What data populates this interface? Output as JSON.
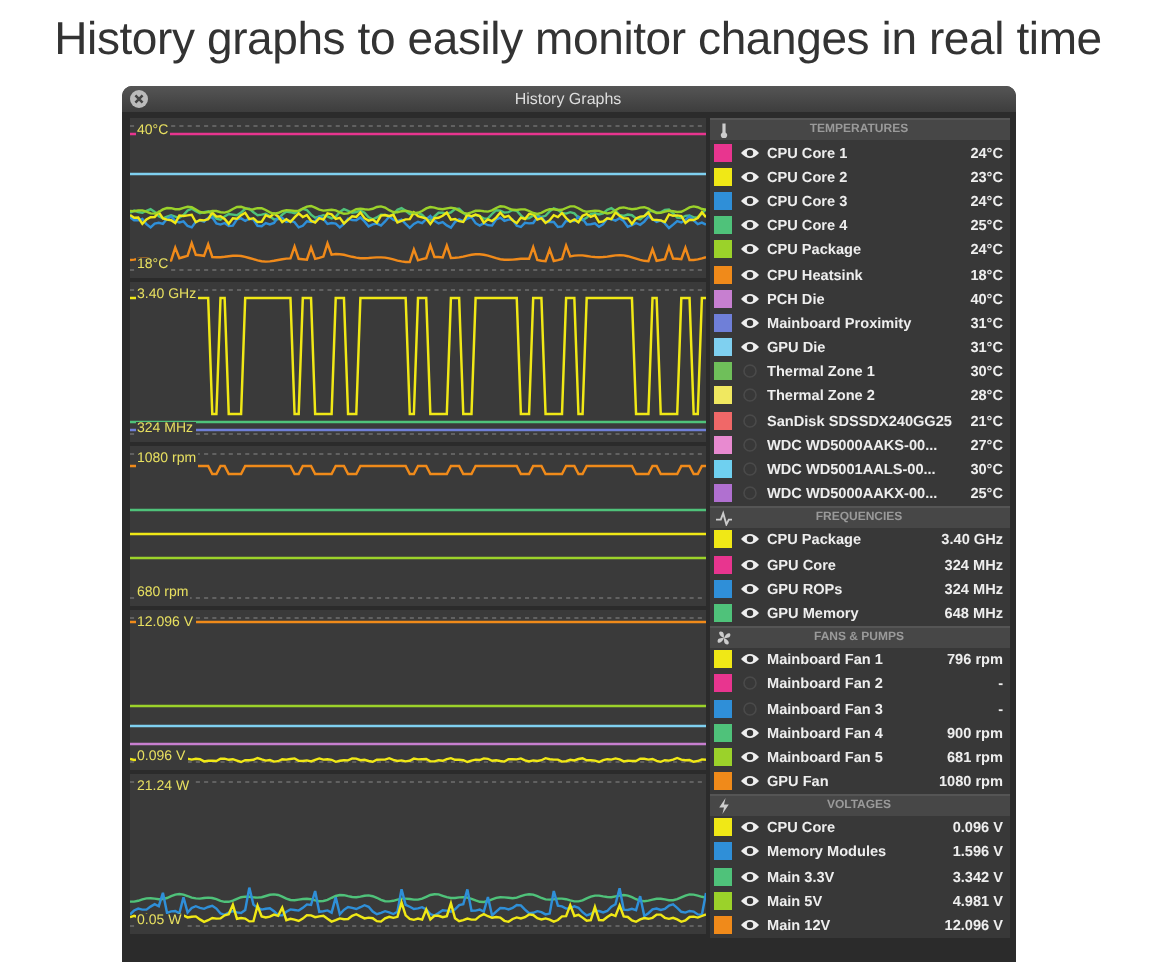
{
  "heading": "History graphs to easily monitor changes in real time",
  "window": {
    "title": "History Graphs"
  },
  "graphs": [
    {
      "kind": "temperatures",
      "top_label": "40°C",
      "bottom_label": "18°C"
    },
    {
      "kind": "frequencies",
      "top_label": "3.40 GHz",
      "bottom_label": "324 MHz"
    },
    {
      "kind": "fans",
      "top_label": "1080 rpm",
      "bottom_label": "680 rpm"
    },
    {
      "kind": "voltages",
      "top_label": "12.096 V",
      "bottom_label": "0.096 V"
    },
    {
      "kind": "power",
      "top_label": "21.24 W",
      "bottom_label": "0.05 W"
    }
  ],
  "sections": [
    {
      "kind": "temperatures",
      "title": "TEMPERATURES",
      "items": [
        {
          "name": "CPU Core 1",
          "value": "24°C",
          "color": "#e8358f",
          "visible": true
        },
        {
          "name": "CPU Core 2",
          "value": "23°C",
          "color": "#f0e816",
          "visible": true
        },
        {
          "name": "CPU Core 3",
          "value": "24°C",
          "color": "#2f8fd8",
          "visible": true
        },
        {
          "name": "CPU Core 4",
          "value": "25°C",
          "color": "#4fc27a",
          "visible": true
        },
        {
          "name": "CPU Package",
          "value": "24°C",
          "color": "#9bd22a",
          "visible": true
        },
        {
          "name": "CPU Heatsink",
          "value": "18°C",
          "color": "#f08a1a",
          "visible": true
        },
        {
          "name": "PCH Die",
          "value": "40°C",
          "color": "#c77fd0",
          "visible": true
        },
        {
          "name": "Mainboard Proximity",
          "value": "31°C",
          "color": "#6f7fd8",
          "visible": true
        },
        {
          "name": "GPU Die",
          "value": "31°C",
          "color": "#7fd0f0",
          "visible": true
        },
        {
          "name": "Thermal Zone 1",
          "value": "30°C",
          "color": "#6fbf5a",
          "visible": false
        },
        {
          "name": "Thermal Zone 2",
          "value": "28°C",
          "color": "#f0e860",
          "visible": false
        },
        {
          "name": "SanDisk SDSSDX240GG25",
          "value": "21°C",
          "color": "#f06868",
          "visible": false
        },
        {
          "name": "WDC WD5000AAKS-00...",
          "value": "27°C",
          "color": "#e88ad0",
          "visible": false
        },
        {
          "name": "WDC WD5001AALS-00...",
          "value": "30°C",
          "color": "#6fd0f0",
          "visible": false
        },
        {
          "name": "WDC WD5000AAKX-00...",
          "value": "25°C",
          "color": "#b070d0",
          "visible": false
        }
      ]
    },
    {
      "kind": "frequencies",
      "title": "FREQUENCIES",
      "items": [
        {
          "name": "CPU Package",
          "value": "3.40 GHz",
          "color": "#f0e816",
          "visible": true
        },
        {
          "name": "GPU Core",
          "value": "324 MHz",
          "color": "#e8358f",
          "visible": true
        },
        {
          "name": "GPU ROPs",
          "value": "324 MHz",
          "color": "#2f8fd8",
          "visible": true
        },
        {
          "name": "GPU Memory",
          "value": "648 MHz",
          "color": "#4fc27a",
          "visible": true
        }
      ]
    },
    {
      "kind": "fans",
      "title": "FANS & PUMPS",
      "items": [
        {
          "name": "Mainboard Fan 1",
          "value": "796 rpm",
          "color": "#f0e816",
          "visible": true
        },
        {
          "name": "Mainboard Fan 2",
          "value": "-",
          "color": "#e8358f",
          "visible": false
        },
        {
          "name": "Mainboard Fan 3",
          "value": "-",
          "color": "#2f8fd8",
          "visible": false
        },
        {
          "name": "Mainboard Fan 4",
          "value": "900 rpm",
          "color": "#4fc27a",
          "visible": true
        },
        {
          "name": "Mainboard Fan 5",
          "value": "681 rpm",
          "color": "#9bd22a",
          "visible": true
        },
        {
          "name": "GPU Fan",
          "value": "1080 rpm",
          "color": "#f08a1a",
          "visible": true
        }
      ]
    },
    {
      "kind": "voltages",
      "title": "VOLTAGES",
      "items": [
        {
          "name": "CPU Core",
          "value": "0.096 V",
          "color": "#f0e816",
          "visible": true
        },
        {
          "name": "Memory Modules",
          "value": "1.596 V",
          "color": "#2f8fd8",
          "visible": true
        },
        {
          "name": "Main 3.3V",
          "value": "3.342 V",
          "color": "#4fc27a",
          "visible": true
        },
        {
          "name": "Main 5V",
          "value": "4.981 V",
          "color": "#9bd22a",
          "visible": true
        },
        {
          "name": "Main 12V",
          "value": "12.096 V",
          "color": "#f08a1a",
          "visible": true
        }
      ]
    }
  ]
}
